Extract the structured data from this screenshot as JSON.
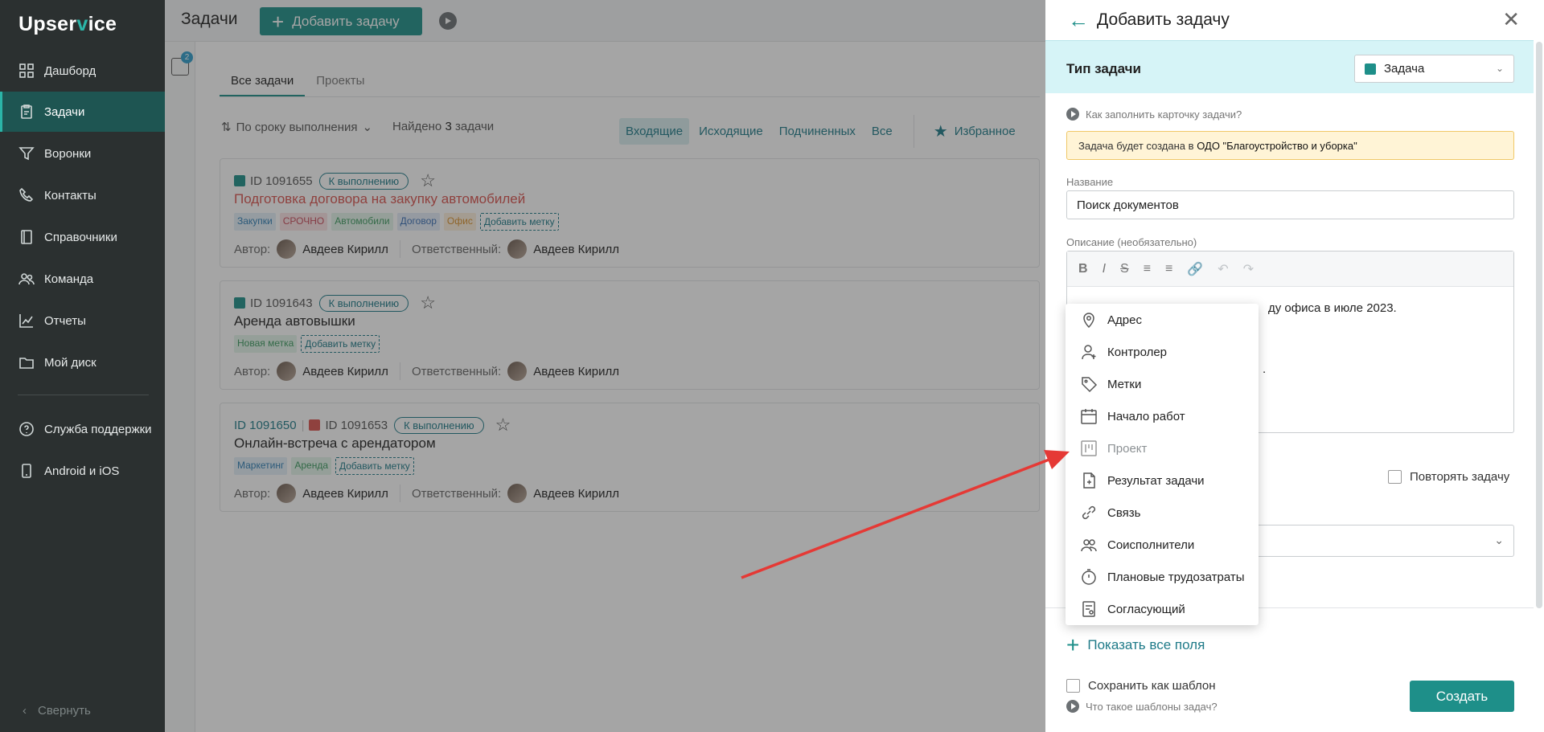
{
  "sidebar": {
    "logo_pre": "Upser",
    "logo_v": "v",
    "logo_post": "ice",
    "items": [
      {
        "label": "Дашборд",
        "icon": "dashboard-icon"
      },
      {
        "label": "Задачи",
        "icon": "tasks-icon",
        "active": true
      },
      {
        "label": "Воронки",
        "icon": "funnel-icon"
      },
      {
        "label": "Контакты",
        "icon": "phone-icon"
      },
      {
        "label": "Справочники",
        "icon": "book-icon"
      },
      {
        "label": "Команда",
        "icon": "team-icon"
      },
      {
        "label": "Отчеты",
        "icon": "chart-icon"
      },
      {
        "label": "Мой диск",
        "icon": "folder-icon"
      },
      {
        "label": "Служба поддержки",
        "icon": "help-icon"
      },
      {
        "label": "Android и iOS",
        "icon": "mobile-icon"
      }
    ],
    "collapse_label": "Свернуть"
  },
  "header": {
    "title": "Задачи",
    "add_button": "Добавить задачу",
    "filter_badge": "2"
  },
  "tabs": [
    "Все задачи",
    "Проекты"
  ],
  "toolbar": {
    "sort_label": "По сроку выполнения",
    "found_prefix": "Найдено",
    "found_count": "3",
    "found_suffix": "задачи",
    "filters": [
      "Входящие",
      "Исходящие",
      "Подчиненных",
      "Все"
    ],
    "favorites": "Избранное"
  },
  "tasks": [
    {
      "id": "ID 1091655",
      "status": "К выполнению",
      "title": "Подготовка договора на закупку автомобилей",
      "tags": [
        {
          "text": "Закупки",
          "bg": "#e3f0f8",
          "color": "#2f7fb5"
        },
        {
          "text": "СРОЧНО",
          "bg": "#fbe3e6",
          "color": "#c94a5a"
        },
        {
          "text": "Автомобили",
          "bg": "#e3f5ea",
          "color": "#3c9a5f"
        },
        {
          "text": "Договор",
          "bg": "#e3ecf8",
          "color": "#3a6fb5"
        },
        {
          "text": "Офис",
          "bg": "#fdf0dd",
          "color": "#d9902c"
        }
      ],
      "add_tag": "Добавить метку",
      "author_label": "Автор:",
      "author": "Авдеев Кирилл",
      "resp_label": "Ответственный:",
      "resp": "Авдеев Кирилл"
    },
    {
      "id": "ID 1091643",
      "status": "К выполнению",
      "title": "Аренда автовышки",
      "tags": [
        {
          "text": "Новая метка",
          "bg": "#e3f5ea",
          "color": "#3c9a5f"
        }
      ],
      "add_tag": "Добавить метку",
      "author_label": "Автор:",
      "author": "Авдеев Кирилл",
      "resp_label": "Ответственный:",
      "resp": "Авдеев Кирилл"
    },
    {
      "parent_id": "ID 1091650",
      "id": "ID 1091653",
      "status": "К выполнению",
      "title": "Онлайн-встреча с арендатором",
      "tags": [
        {
          "text": "Маркетинг",
          "bg": "#e3f0f8",
          "color": "#2f7fb5"
        },
        {
          "text": "Аренда",
          "bg": "#e3f5ea",
          "color": "#3c9a5f"
        }
      ],
      "add_tag": "Добавить метку",
      "author_label": "Автор:",
      "author": "Авдеев Кирилл",
      "resp_label": "Ответственный:",
      "resp": "Авдеев Кирилл"
    }
  ],
  "panel": {
    "title": "Добавить задачу",
    "type_label": "Тип задачи",
    "type_value": "Задача",
    "howto": "Как заполнить карточку задачи?",
    "notice_prefix": "Задача будет создана в",
    "notice_org": "ОДО \"Благоустройство и уборка\"",
    "name_label": "Название",
    "name_value": "Поиск документов",
    "desc_label": "Описание (необязательно)",
    "desc_text": "ду офиса в июле 2023.",
    "desc_text2": ".",
    "repeat_label": "Повторять задачу",
    "show_all": "Показать все поля",
    "save_template": "Сохранить как шаблон",
    "what_templates": "Что такое шаблоны задач?",
    "create": "Создать"
  },
  "popup": {
    "items": [
      {
        "label": "Адрес",
        "icon": "location-icon"
      },
      {
        "label": "Контролер",
        "icon": "user-add-icon"
      },
      {
        "label": "Метки",
        "icon": "tag-icon"
      },
      {
        "label": "Начало работ",
        "icon": "calendar-icon"
      },
      {
        "label": "Проект",
        "icon": "project-board-icon",
        "disabled": true
      },
      {
        "label": "Результат задачи",
        "icon": "document-icon"
      },
      {
        "label": "Связь",
        "icon": "link-icon"
      },
      {
        "label": "Соисполнители",
        "icon": "users-icon"
      },
      {
        "label": "Плановые трудозатраты",
        "icon": "stopwatch-icon"
      },
      {
        "label": "Согласующий",
        "icon": "approval-icon"
      }
    ]
  },
  "colors": {
    "accent": "#1e8f89",
    "sidebar_bg": "#2b3030",
    "arrow": "#e53935"
  }
}
